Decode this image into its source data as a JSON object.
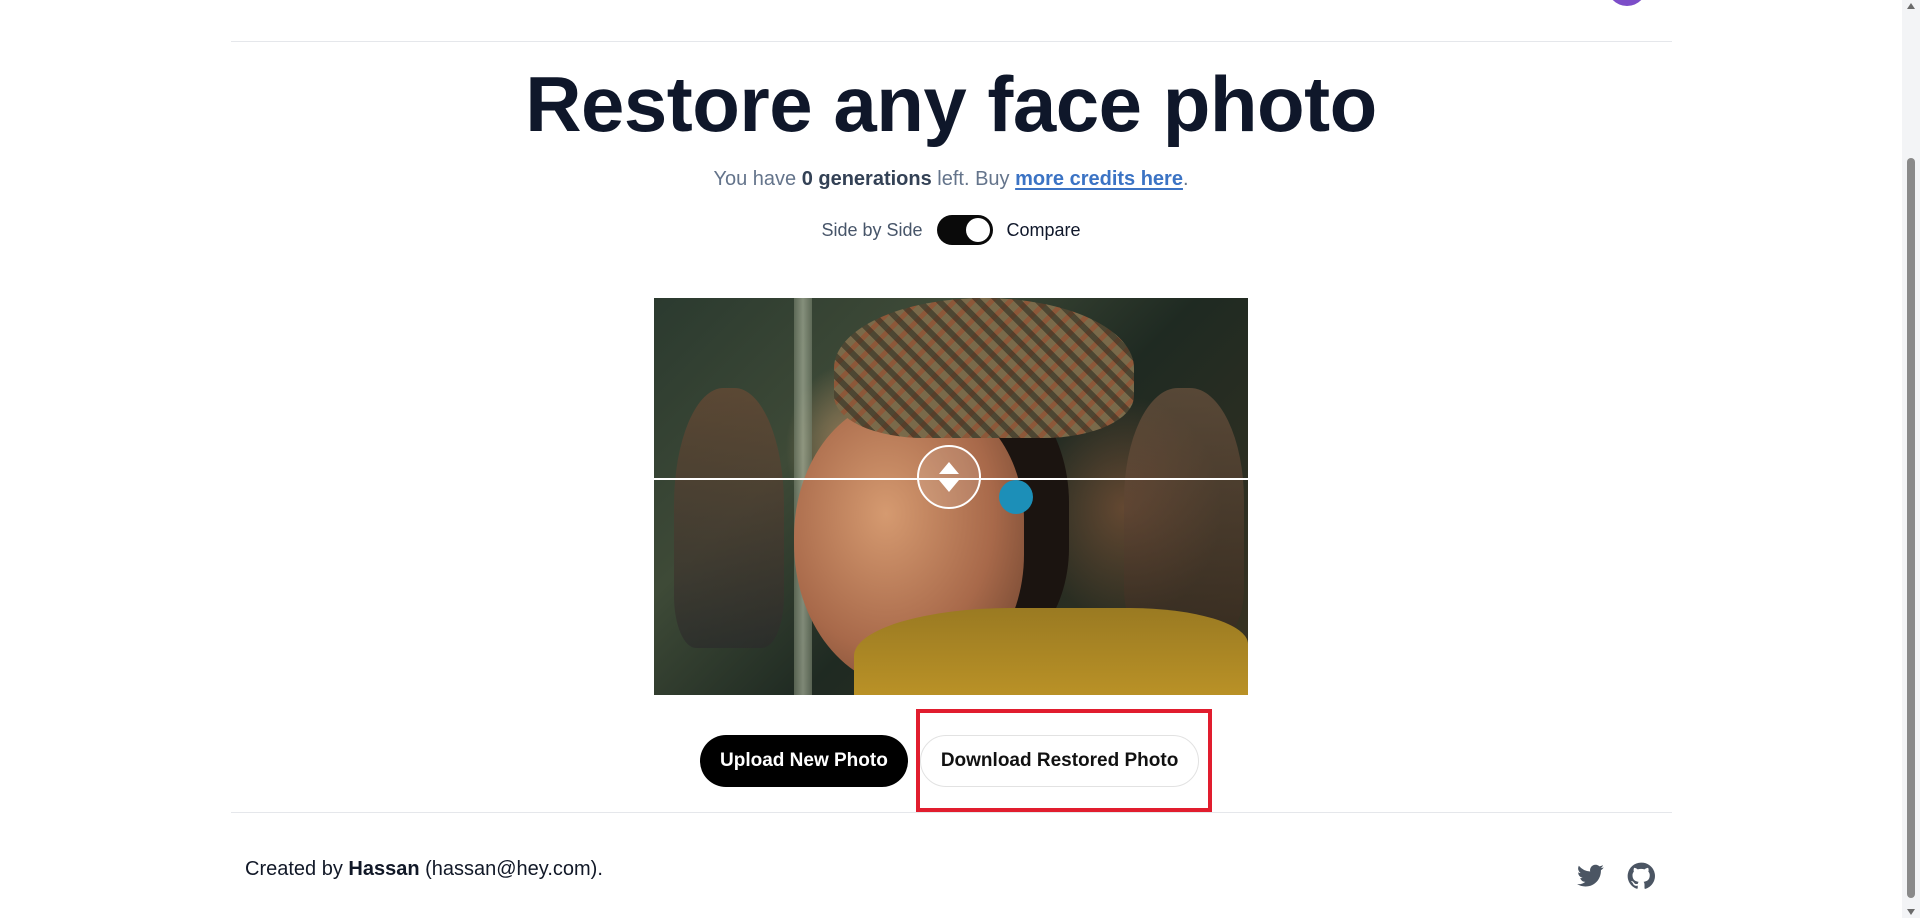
{
  "header": {
    "avatar_icon": "user-avatar"
  },
  "main": {
    "title": "Restore any face photo",
    "credits": {
      "prefix": "You have ",
      "count": "0 generations",
      "middle": " left. Buy ",
      "link": "more credits here",
      "suffix": "."
    },
    "toggle": {
      "left_label": "Side by Side",
      "right_label": "Compare",
      "state": "on"
    },
    "compare_handle_icon": "up-down-arrows-icon",
    "buttons": {
      "upload": "Upload New Photo",
      "download": "Download Restored Photo"
    }
  },
  "footer": {
    "prefix": "Created by ",
    "author": "Hassan",
    "email": " (hassan@hey.com).",
    "social_icons": [
      "twitter-icon",
      "github-icon"
    ]
  },
  "colors": {
    "title": "#0f172a",
    "link": "#3b73c4",
    "highlight": "#e11d2e",
    "avatar": "#7c4dc8"
  }
}
